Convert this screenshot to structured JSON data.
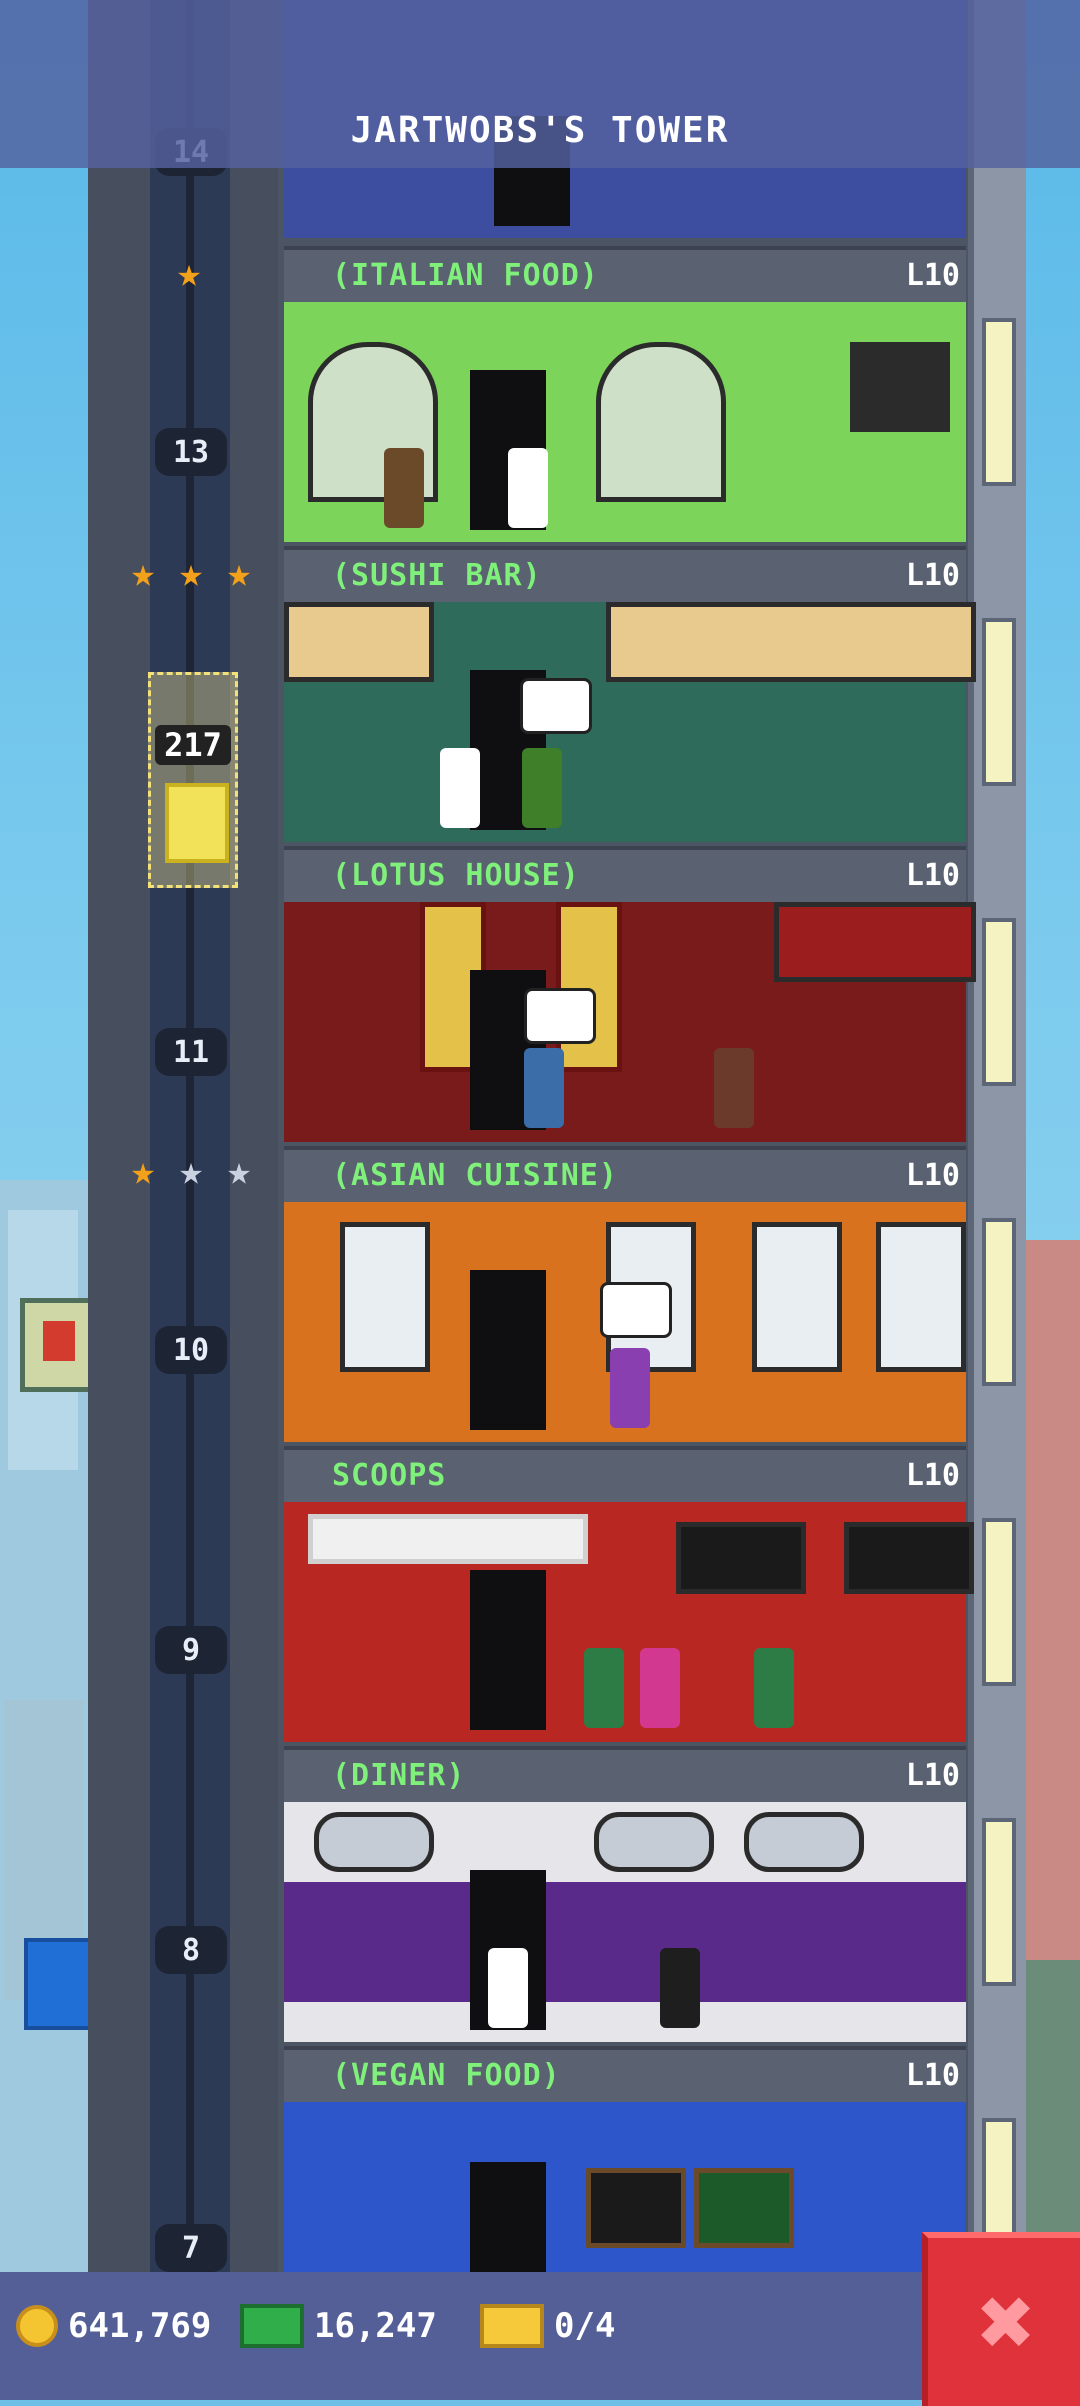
{
  "header": {
    "title": "JARTWOBS'S TOWER"
  },
  "floor_numbers": [
    "14",
    "13",
    "11",
    "10",
    "9",
    "8",
    "7"
  ],
  "elevator": {
    "count": "217"
  },
  "floors": [
    {
      "name": "(ITALIAN FOOD)",
      "level": "L10",
      "color": "#7cd45a"
    },
    {
      "name": "(SUSHI BAR)",
      "level": "L10",
      "color": "#2f6b5a"
    },
    {
      "name": "(LOTUS HOUSE)",
      "level": "L10",
      "color": "#7a1b1b"
    },
    {
      "name": "(ASIAN CUISINE)",
      "level": "L10",
      "color": "#d8721e"
    },
    {
      "name": "SCOOPS",
      "level": "L10",
      "color": "#b82721"
    },
    {
      "name": "(DINER)",
      "level": "L10",
      "color": "#e6e6ea"
    },
    {
      "name": "(VEGAN FOOD)",
      "level": "L10",
      "color": "#2c56c9"
    }
  ],
  "resources": {
    "coins": "641,769",
    "bux": "16,247",
    "tickets": "0/4"
  },
  "icons": {
    "coin": "coin-icon",
    "bux": "bux-icon",
    "ticket": "vip-ticket-icon",
    "close": "close-icon",
    "star": "star-icon"
  }
}
